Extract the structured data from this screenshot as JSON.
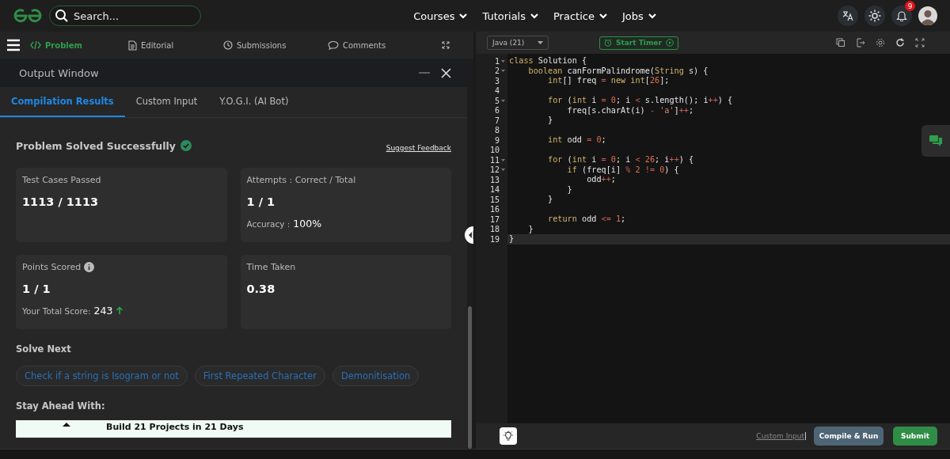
{
  "top_nav": {
    "search": {
      "placeholder": "Search..."
    },
    "menus": [
      {
        "label": "Courses"
      },
      {
        "label": "Tutorials"
      },
      {
        "label": "Practice"
      },
      {
        "label": "Jobs"
      }
    ],
    "notification_count": "9"
  },
  "problem_tabs": [
    {
      "label": "Problem",
      "selected": true
    },
    {
      "label": "Editorial",
      "selected": false
    },
    {
      "label": "Submissions",
      "selected": false
    },
    {
      "label": "Comments",
      "selected": false
    }
  ],
  "output_window": {
    "title": "Output Window",
    "tabs": [
      {
        "label": "Compilation Results",
        "selected": true
      },
      {
        "label": "Custom Input",
        "selected": false
      },
      {
        "label": "Y.O.G.I. (AI Bot)",
        "selected": false
      }
    ],
    "status": "Problem Solved Successfully",
    "feedback_link": "Suggest Feedback",
    "cards": [
      {
        "label": "Test Cases Passed",
        "value": "1113 / 1113"
      },
      {
        "label": "Attempts : Correct / Total",
        "value": "1 / 1",
        "detail_label": "Accuracy :",
        "detail_value": "100%"
      },
      {
        "label": "Points Scored",
        "info": true,
        "value": "1 / 1",
        "detail_label": "Your Total Score:",
        "detail_value": "243",
        "rising": true
      },
      {
        "label": "Time Taken",
        "value": "0.38"
      }
    ],
    "solve_next": {
      "heading": "Solve Next",
      "items": [
        "Check if a string is Isogram or not",
        "First Repeated Character",
        "Demonitisation"
      ]
    },
    "stay_ahead": {
      "heading": "Stay Ahead With:",
      "banner": "Build 21 Projects in 21 Days"
    }
  },
  "editor": {
    "language": "Java (21)",
    "timer_button": "Start Timer",
    "lines": [
      {
        "number": "1",
        "foldable": true,
        "active": false,
        "tokens": [
          {
            "kind": "kw",
            "text": "class"
          },
          {
            "kind": "txt",
            "text": " Solution {"
          }
        ]
      },
      {
        "number": "2",
        "foldable": true,
        "active": false,
        "tokens": [
          {
            "kind": "kw",
            "text": "    boolean"
          },
          {
            "kind": "txt",
            "text": " canFormPalindrome("
          },
          {
            "kind": "kw",
            "text": "String"
          },
          {
            "kind": "txt",
            "text": " s) {"
          }
        ]
      },
      {
        "number": "3",
        "foldable": false,
        "active": false,
        "tokens": [
          {
            "kind": "kw",
            "text": "        int"
          },
          {
            "kind": "txt",
            "text": "[] freq "
          },
          {
            "kind": "op",
            "text": "= "
          },
          {
            "kind": "kw",
            "text": "new int"
          },
          {
            "kind": "txt",
            "text": "["
          },
          {
            "kind": "num",
            "text": "26"
          },
          {
            "kind": "txt",
            "text": "];"
          }
        ]
      },
      {
        "number": "4",
        "foldable": false,
        "active": false
      },
      {
        "number": "5",
        "foldable": true,
        "active": false,
        "tokens": [
          {
            "kind": "kw",
            "text": "        for"
          },
          {
            "kind": "txt",
            "text": " ("
          },
          {
            "kind": "kw",
            "text": "int"
          },
          {
            "kind": "txt",
            "text": " i "
          },
          {
            "kind": "op",
            "text": "= "
          },
          {
            "kind": "num",
            "text": "0"
          },
          {
            "kind": "txt",
            "text": "; i "
          },
          {
            "kind": "op",
            "text": "<"
          },
          {
            "kind": "txt",
            "text": " s.length(); i"
          },
          {
            "kind": "op",
            "text": "++"
          },
          {
            "kind": "txt",
            "text": ") {"
          }
        ]
      },
      {
        "number": "6",
        "foldable": false,
        "active": false,
        "tokens": [
          {
            "kind": "txt",
            "text": "            freq[s.charAt(i) "
          },
          {
            "kind": "op",
            "text": "- "
          },
          {
            "kind": "str",
            "text": "'a'"
          },
          {
            "kind": "txt",
            "text": "]"
          },
          {
            "kind": "op",
            "text": "++"
          },
          {
            "kind": "txt",
            "text": ";"
          }
        ]
      },
      {
        "number": "7",
        "foldable": false,
        "active": false,
        "tokens": [
          {
            "kind": "txt",
            "text": "        }"
          }
        ]
      },
      {
        "number": "8",
        "foldable": false,
        "active": false
      },
      {
        "number": "9",
        "foldable": false,
        "active": false,
        "tokens": [
          {
            "kind": "kw",
            "text": "        int"
          },
          {
            "kind": "txt",
            "text": " odd "
          },
          {
            "kind": "op",
            "text": "= "
          },
          {
            "kind": "num",
            "text": "0"
          },
          {
            "kind": "txt",
            "text": ";"
          }
        ]
      },
      {
        "number": "10",
        "foldable": false,
        "active": false
      },
      {
        "number": "11",
        "foldable": true,
        "active": false,
        "tokens": [
          {
            "kind": "kw",
            "text": "        for"
          },
          {
            "kind": "txt",
            "text": " ("
          },
          {
            "kind": "kw",
            "text": "int"
          },
          {
            "kind": "txt",
            "text": " i "
          },
          {
            "kind": "op",
            "text": "= "
          },
          {
            "kind": "num",
            "text": "0"
          },
          {
            "kind": "txt",
            "text": "; i "
          },
          {
            "kind": "op",
            "text": "< "
          },
          {
            "kind": "num",
            "text": "26"
          },
          {
            "kind": "txt",
            "text": "; i"
          },
          {
            "kind": "op",
            "text": "++"
          },
          {
            "kind": "txt",
            "text": ") {"
          }
        ]
      },
      {
        "number": "12",
        "foldable": true,
        "active": false,
        "tokens": [
          {
            "kind": "kw",
            "text": "            if"
          },
          {
            "kind": "txt",
            "text": " (freq[i] "
          },
          {
            "kind": "op",
            "text": "% "
          },
          {
            "kind": "num",
            "text": "2"
          },
          {
            "kind": "op",
            "text": " != "
          },
          {
            "kind": "num",
            "text": "0"
          },
          {
            "kind": "txt",
            "text": ") {"
          }
        ]
      },
      {
        "number": "13",
        "foldable": false,
        "active": false,
        "tokens": [
          {
            "kind": "txt",
            "text": "                odd"
          },
          {
            "kind": "op",
            "text": "++"
          },
          {
            "kind": "txt",
            "text": ";"
          }
        ]
      },
      {
        "number": "14",
        "foldable": false,
        "active": false,
        "tokens": [
          {
            "kind": "txt",
            "text": "            }"
          }
        ]
      },
      {
        "number": "15",
        "foldable": false,
        "active": false,
        "tokens": [
          {
            "kind": "txt",
            "text": "        }"
          }
        ]
      },
      {
        "number": "16",
        "foldable": false,
        "active": false
      },
      {
        "number": "17",
        "foldable": false,
        "active": false,
        "tokens": [
          {
            "kind": "kw",
            "text": "        return"
          },
          {
            "kind": "txt",
            "text": " odd "
          },
          {
            "kind": "op",
            "text": "<= "
          },
          {
            "kind": "num",
            "text": "1"
          },
          {
            "kind": "txt",
            "text": ";"
          }
        ]
      },
      {
        "number": "18",
        "foldable": false,
        "active": false,
        "tokens": [
          {
            "kind": "txt",
            "text": "    }"
          }
        ]
      },
      {
        "number": "19",
        "foldable": false,
        "active": true,
        "tokens": [
          {
            "kind": "txt",
            "text": "}"
          }
        ]
      }
    ]
  },
  "footer": {
    "custom_input_link": "Custom Input",
    "compile_button": "Compile & Run",
    "submit_button": "Submit"
  }
}
